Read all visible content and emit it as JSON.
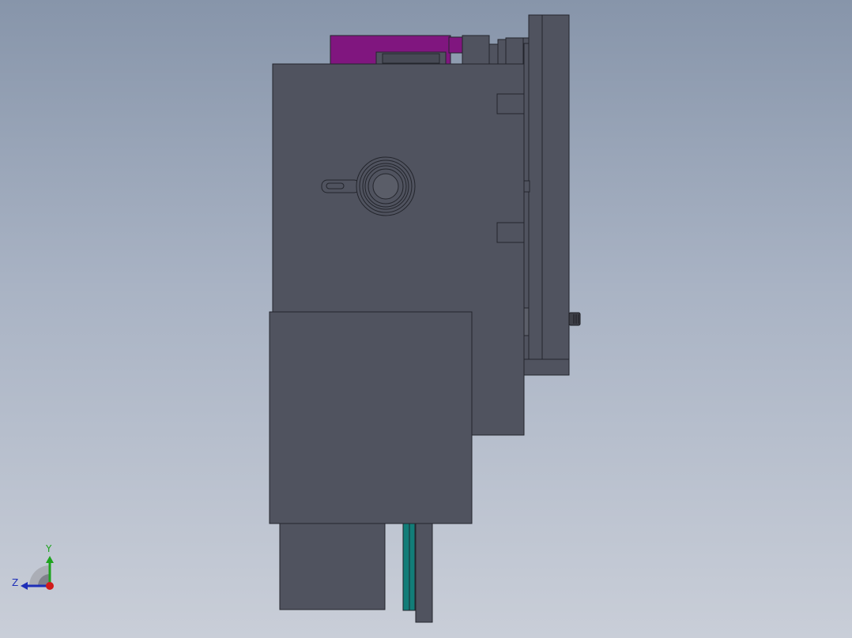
{
  "viewport": {
    "background_top": "#8795aa",
    "background_bottom": "#c9ced8"
  },
  "model": {
    "body_color": "#50535f",
    "edge_color": "#23252c",
    "accent_purple": "#80167f",
    "accent_teal": "#127d78"
  },
  "triad": {
    "y_label": "Y",
    "z_label": "Z",
    "y_color": "#1ea31e",
    "z_color": "#1e2fb8",
    "x_color": "#d11a1a"
  }
}
